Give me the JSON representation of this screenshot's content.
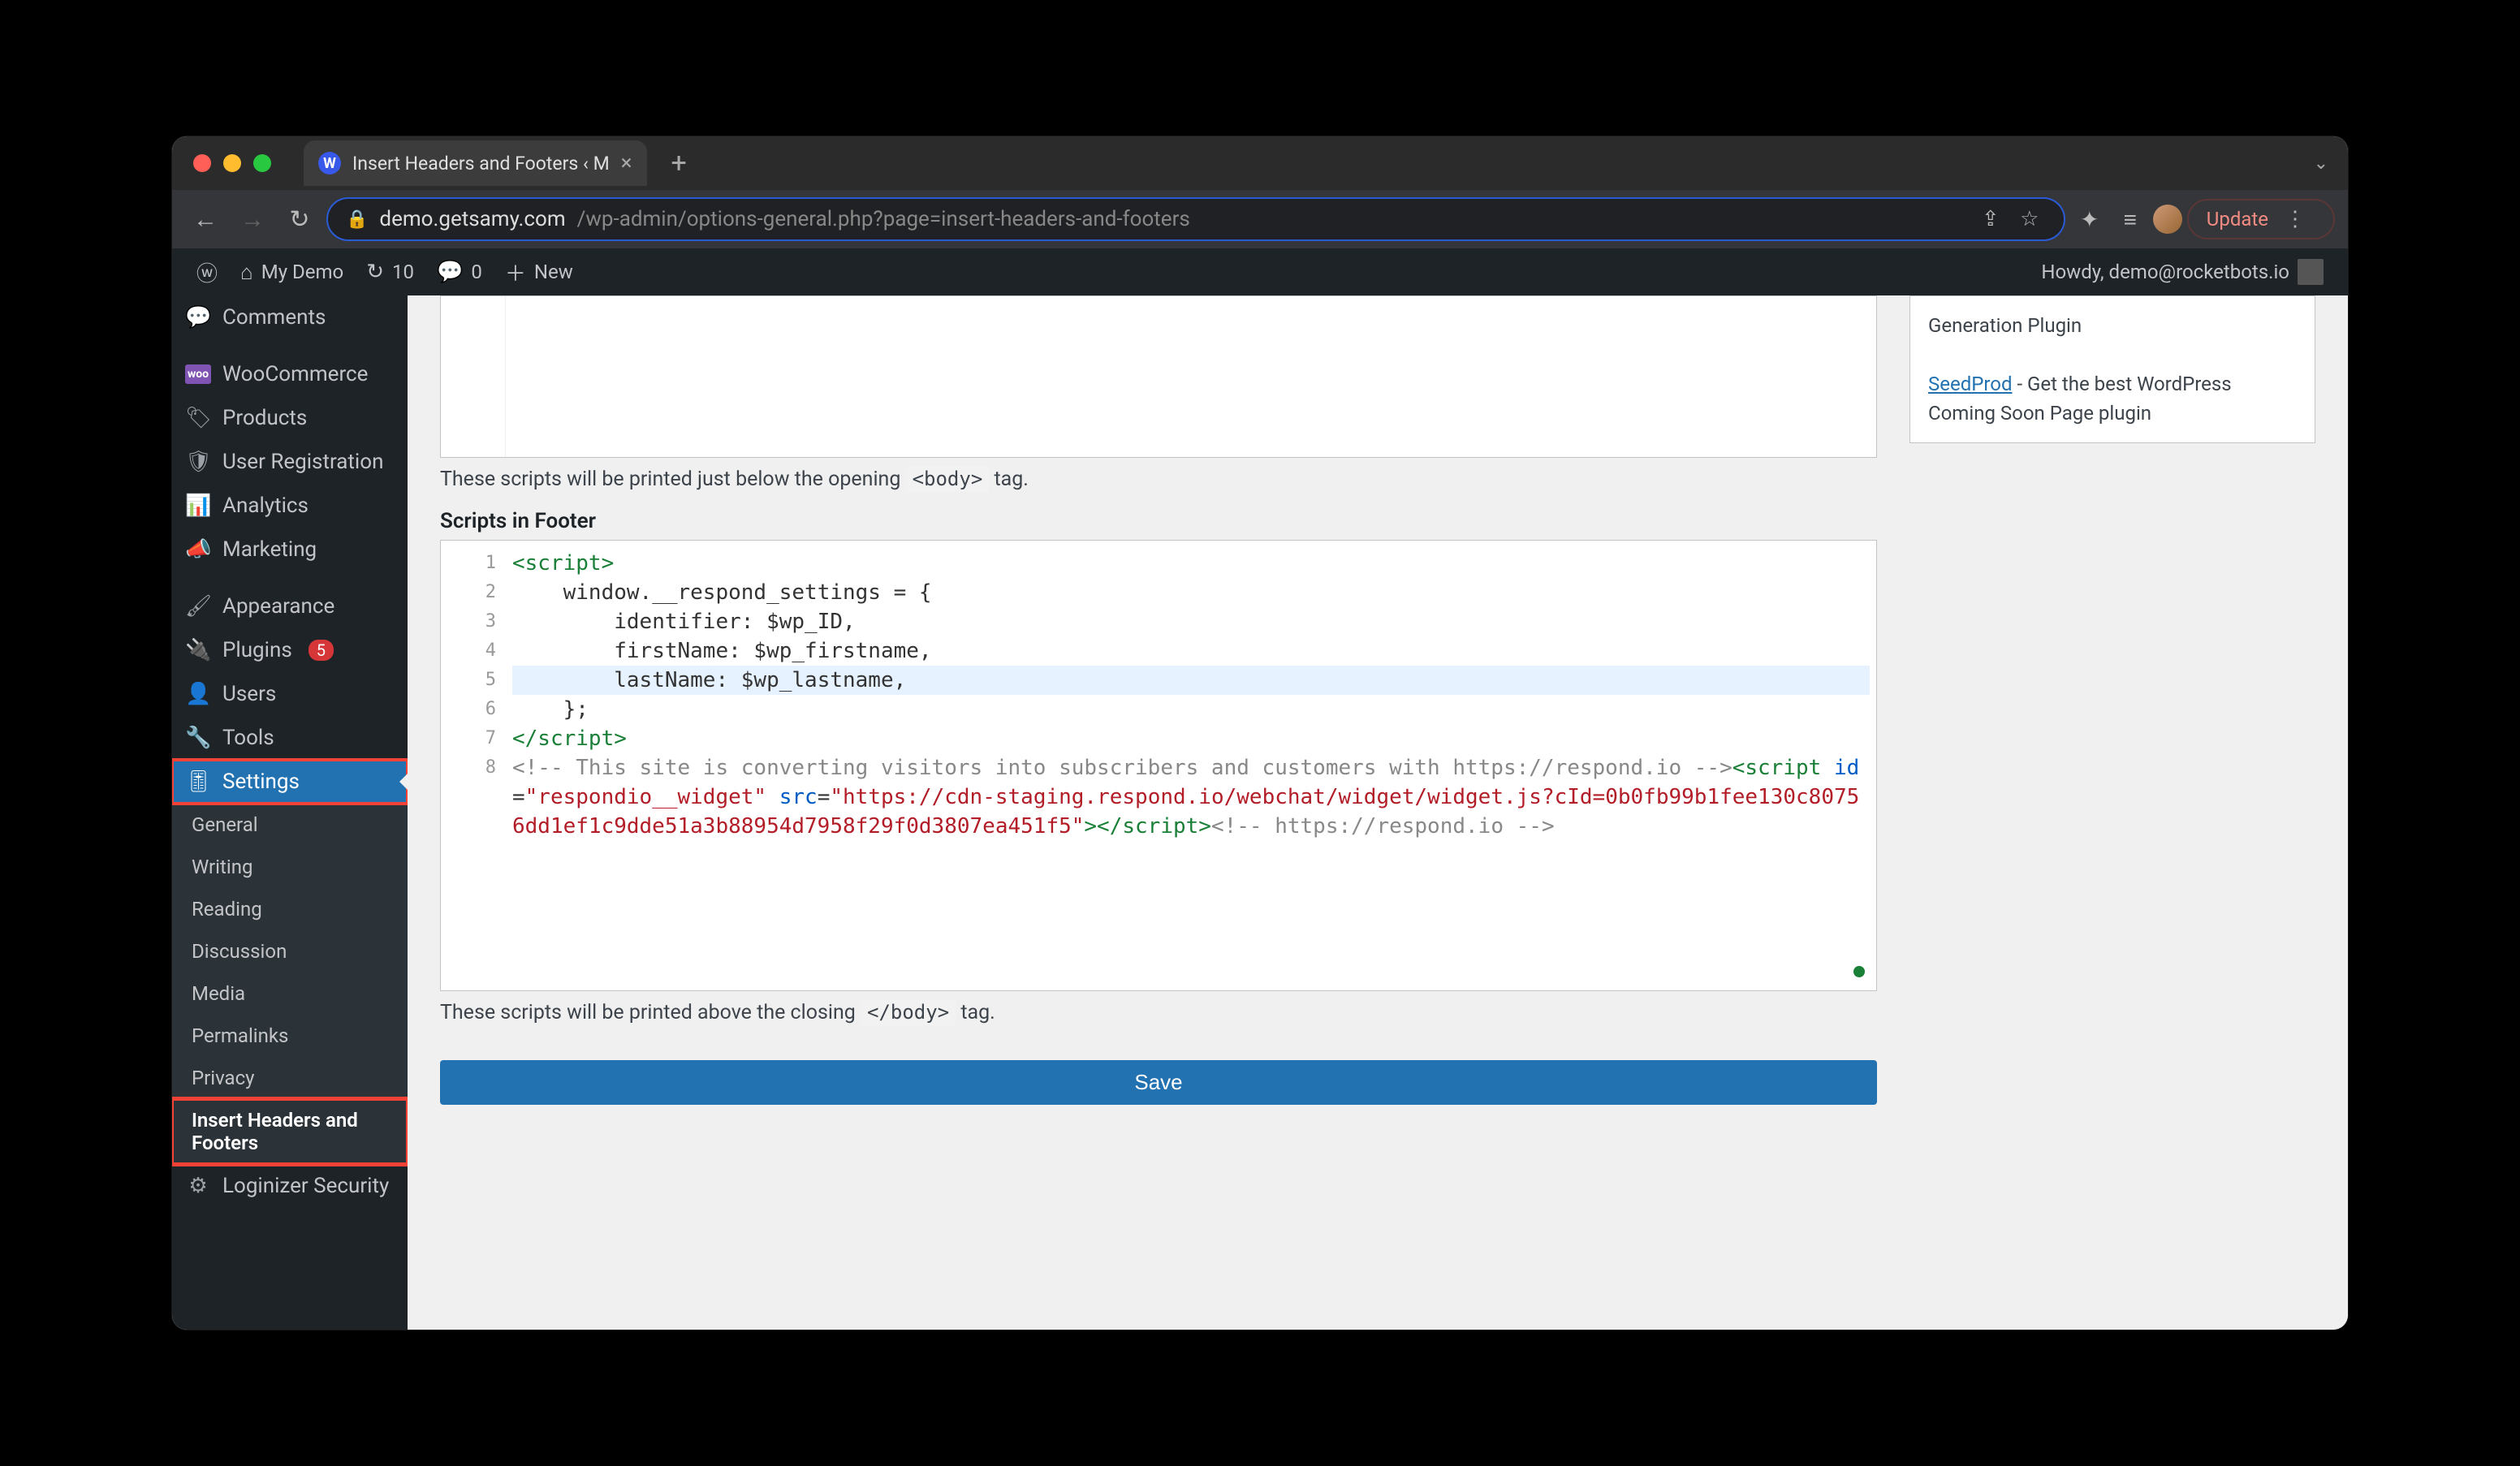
{
  "browser": {
    "tab_title": "Insert Headers and Footers ‹ M",
    "url_host": "demo.getsamy.com",
    "url_rest": "/wp-admin/options-general.php?page=insert-headers-and-footers",
    "update_label": "Update"
  },
  "adminbar": {
    "site_name": "My Demo",
    "updates": "10",
    "comments": "0",
    "new_label": "New",
    "howdy": "Howdy, demo@rocketbots.io"
  },
  "sidebar": {
    "items": [
      {
        "icon": "💬",
        "label": "Comments"
      },
      {
        "icon": "woo",
        "label": "WooCommerce",
        "woo": true
      },
      {
        "icon": "🏷",
        "label": "Products"
      },
      {
        "icon": "🛡",
        "label": "User Registration"
      },
      {
        "icon": "📊",
        "label": "Analytics"
      },
      {
        "icon": "📣",
        "label": "Marketing"
      },
      {
        "icon": "🖌",
        "label": "Appearance"
      },
      {
        "icon": "🔌",
        "label": "Plugins",
        "badge": "5"
      },
      {
        "icon": "👤",
        "label": "Users"
      },
      {
        "icon": "🔧",
        "label": "Tools"
      },
      {
        "icon": "⚙",
        "label": "Settings",
        "current": true,
        "highlighted": true
      },
      {
        "icon": "⚙",
        "label": "Loginizer Security",
        "partial": true
      }
    ],
    "submenu": [
      {
        "label": "General"
      },
      {
        "label": "Writing"
      },
      {
        "label": "Reading"
      },
      {
        "label": "Discussion"
      },
      {
        "label": "Media"
      },
      {
        "label": "Permalinks"
      },
      {
        "label": "Privacy"
      },
      {
        "label": "Insert Headers and Footers",
        "current": true,
        "highlighted": true
      }
    ]
  },
  "content": {
    "body_help_pre": "These scripts will be printed just below the opening ",
    "body_help_code": "<body>",
    "body_help_post": " tag.",
    "footer_label": "Scripts in Footer",
    "footer_help_pre": "These scripts will be printed above the closing ",
    "footer_help_code": "</body>",
    "footer_help_post": " tag.",
    "save_label": "Save"
  },
  "code": {
    "lines": [
      [
        {
          "t": "tag",
          "v": "<script>"
        }
      ],
      [
        {
          "t": "plain",
          "v": "    window.__respond_settings = {"
        }
      ],
      [
        {
          "t": "plain",
          "v": "        identifier: $wp_ID,"
        }
      ],
      [
        {
          "t": "plain",
          "v": "        firstName: $wp_firstname,"
        }
      ],
      [
        {
          "t": "plain",
          "v": "        lastName: $wp_lastname,"
        }
      ],
      [
        {
          "t": "plain",
          "v": "    };"
        }
      ],
      [
        {
          "t": "tag",
          "v": "</script>"
        }
      ],
      [
        {
          "t": "com",
          "v": "<!-- This site is converting visitors into subscribers and customers with https://respond.io -->"
        },
        {
          "t": "tag",
          "v": "<script"
        },
        {
          "t": "plain",
          "v": " "
        },
        {
          "t": "attr",
          "v": "id"
        },
        {
          "t": "plain",
          "v": "="
        },
        {
          "t": "str",
          "v": "\"respondio__widget\""
        },
        {
          "t": "plain",
          "v": " "
        },
        {
          "t": "attr",
          "v": "src"
        },
        {
          "t": "plain",
          "v": "="
        },
        {
          "t": "str",
          "v": "\"https://cdn-staging.respond.io/webchat/widget/widget.js?cId=0b0fb99b1fee130c80756dd1ef1c9dde51a3b88954d7958f29f0d3807ea451f5\""
        },
        {
          "t": "tag",
          "v": "></script>"
        },
        {
          "t": "com",
          "v": "<!-- https://respond.io -->"
        }
      ]
    ],
    "active_line": 5
  },
  "sidebox": {
    "line1_pre": "Generation Plugin",
    "seedprod_label": "SeedProd",
    "seedprod_text": " - Get the best WordPress Coming Soon Page plugin"
  }
}
